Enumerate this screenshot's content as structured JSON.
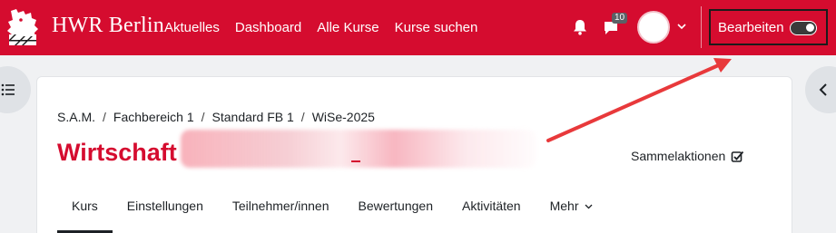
{
  "brand": {
    "name": "HWR Berlin"
  },
  "nav": {
    "links": [
      "Aktuelles",
      "Dashboard",
      "Alle Kurse",
      "Kurse suchen"
    ],
    "message_count": "10",
    "edit_label": "Bearbeiten",
    "edit_mode_on": true
  },
  "breadcrumb": [
    "S.A.M.",
    "Fachbereich 1",
    "Standard FB 1",
    "WiSe-2025"
  ],
  "course": {
    "title_visible": "Wirtschaft"
  },
  "bulk_actions_label": "Sammelaktionen",
  "tabs": [
    "Kurs",
    "Einstellungen",
    "Teilnehmer/innen",
    "Bewertungen",
    "Aktivitäten",
    "Mehr"
  ],
  "active_tab": "Kurs",
  "colors": {
    "brand_red": "#d50c2f",
    "annotation_red": "#e8393b"
  },
  "icons": [
    "bell-icon",
    "chat-icon",
    "chevron-down-icon",
    "toggle-icon",
    "list-icon",
    "chevron-left-icon",
    "bulk-edit-icon"
  ]
}
